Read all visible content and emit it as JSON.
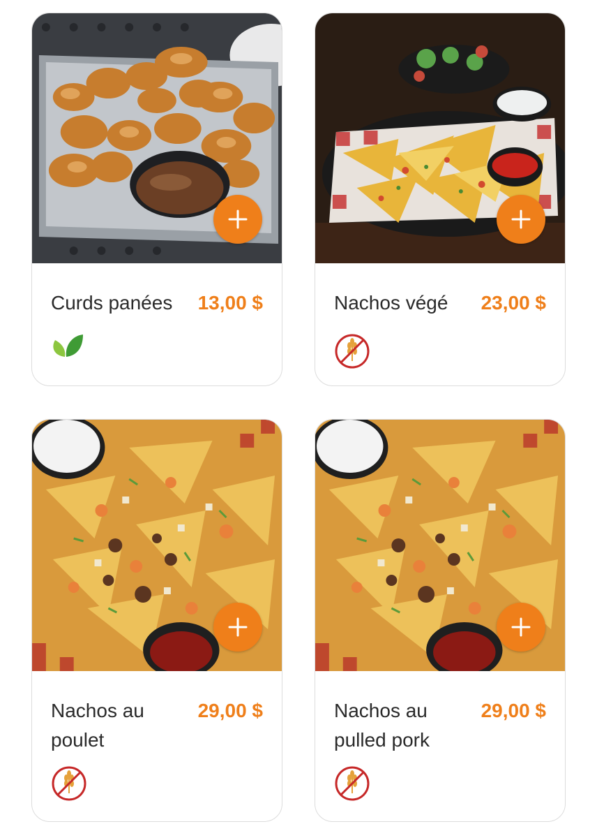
{
  "products": [
    {
      "name": "Curds panées",
      "price": "13,00 $",
      "badge_icon": "vegetarian-leaf-icon"
    },
    {
      "name": "Nachos végé",
      "price": "23,00 $",
      "badge_icon": "gluten-free-icon"
    },
    {
      "name": "Nachos au poulet",
      "price": "29,00 $",
      "badge_icon": "gluten-free-icon"
    },
    {
      "name": "Nachos au pulled pork",
      "price": "29,00 $",
      "badge_icon": "gluten-free-icon"
    }
  ],
  "colors": {
    "accent": "#ef7f1a",
    "leaf": "#6cc04a",
    "gluten_free": "#c62828"
  }
}
